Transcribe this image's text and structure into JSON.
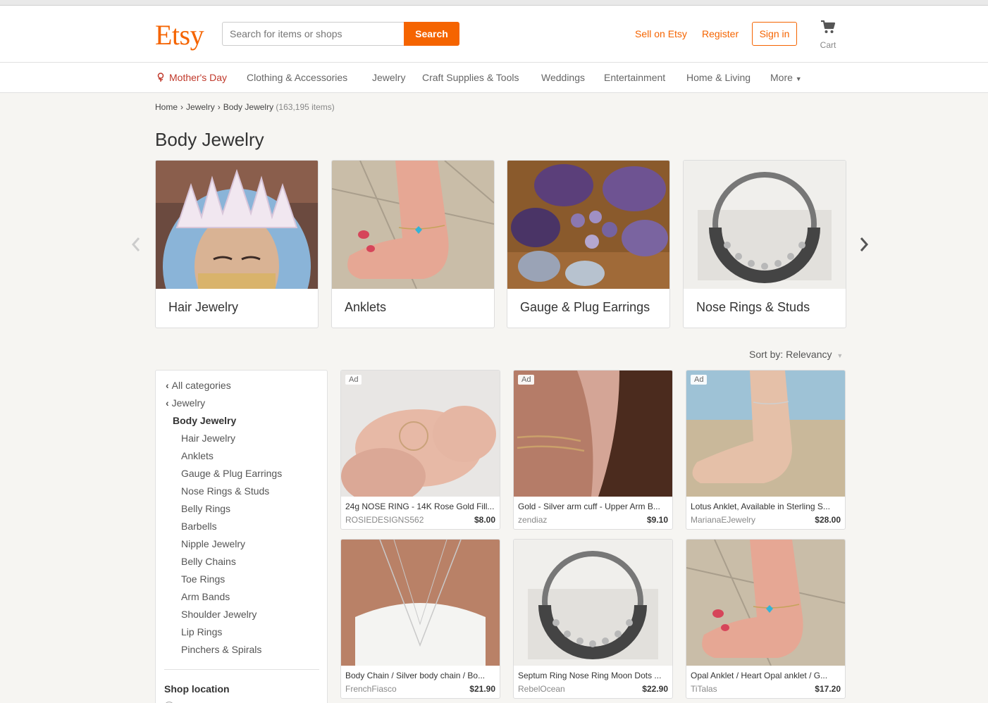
{
  "header": {
    "logo": "Etsy",
    "search_placeholder": "Search for items or shops",
    "search_button": "Search",
    "sell_link": "Sell on Etsy",
    "register_link": "Register",
    "signin_button": "Sign in",
    "cart_label": "Cart",
    "brand_color": "#f56400"
  },
  "category_nav": {
    "items": [
      "Mother's Day",
      "Clothing & Accessories",
      "Jewelry",
      "Craft Supplies & Tools",
      "Weddings",
      "Entertainment",
      "Home & Living",
      "More"
    ]
  },
  "breadcrumb": {
    "home": "Home",
    "jewelry": "Jewelry",
    "current": "Body Jewelry",
    "count": "(163,195 items)"
  },
  "page_title": "Body Jewelry",
  "category_cards": [
    {
      "label": "Hair Jewelry"
    },
    {
      "label": "Anklets"
    },
    {
      "label": "Gauge & Plug Earrings"
    },
    {
      "label": "Nose Rings & Studs"
    }
  ],
  "sort": {
    "label": "Sort by: Relevancy"
  },
  "sidebar": {
    "all_categories": "All categories",
    "parent": "Jewelry",
    "current": "Body Jewelry",
    "subcategories": [
      "Hair Jewelry",
      "Anklets",
      "Gauge & Plug Earrings",
      "Nose Rings & Studs",
      "Belly Rings",
      "Barbells",
      "Nipple Jewelry",
      "Belly Chains",
      "Toe Rings",
      "Arm Bands",
      "Shoulder Jewelry",
      "Lip Rings",
      "Pinchers & Spirals"
    ],
    "shop_location_heading": "Shop location"
  },
  "listings": [
    {
      "ad": "Ad",
      "title": "24g NOSE RING - 14K Rose Gold Fill...",
      "shop": "ROSIEDESIGNS562",
      "price": "$8.00"
    },
    {
      "ad": "Ad",
      "title": "Gold - Silver arm cuff - Upper Arm B...",
      "shop": "zendiaz",
      "price": "$9.10"
    },
    {
      "ad": "Ad",
      "title": "Lotus Anklet, Available in Sterling S...",
      "shop": "MarianaEJewelry",
      "price": "$28.00"
    },
    {
      "title": "Body Chain / Silver body chain / Bo...",
      "shop": "FrenchFiasco",
      "price": "$21.90"
    },
    {
      "title": "Septum Ring Nose Ring Moon Dots ...",
      "shop": "RebelOcean",
      "price": "$22.90"
    },
    {
      "title": "Opal Anklet / Heart Opal anklet / G...",
      "shop": "TiTalas",
      "price": "$17.20"
    }
  ]
}
